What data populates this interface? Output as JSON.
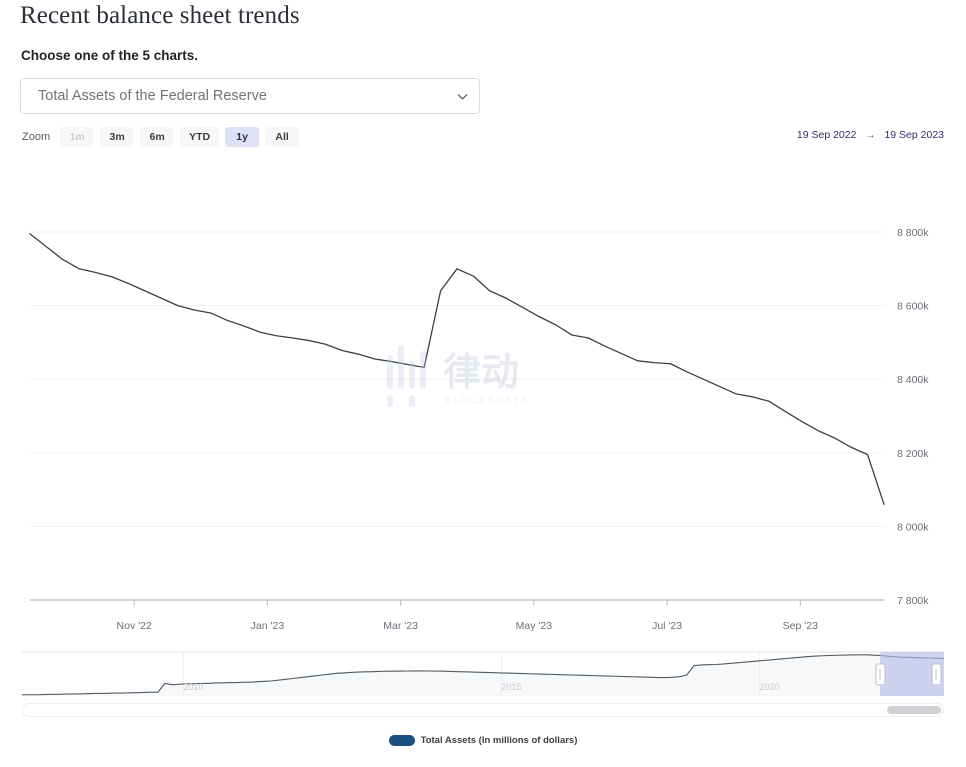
{
  "header": {
    "title": "Recent balance sheet trends",
    "subtitle": "Choose one of the 5 charts."
  },
  "selector": {
    "value": "Total Assets of the Federal Reserve",
    "chevron_icon": "chevron-down-icon",
    "options": [
      "Total Assets of the Federal Reserve"
    ]
  },
  "range_selector": {
    "label": "Zoom",
    "buttons": [
      {
        "label": "1m",
        "state": "disabled"
      },
      {
        "label": "3m",
        "state": "normal"
      },
      {
        "label": "6m",
        "state": "normal"
      },
      {
        "label": "YTD",
        "state": "normal"
      },
      {
        "label": "1y",
        "state": "selected"
      },
      {
        "label": "All",
        "state": "normal"
      }
    ],
    "date_from": "19 Sep 2022",
    "date_separator": "→",
    "date_to": "19 Sep 2023"
  },
  "navigator": {
    "year_labels": [
      "2010",
      "2015",
      "2020"
    ],
    "selection_label": "navigator-selection",
    "handle_left": "navigator-handle-left",
    "handle_right": "navigator-handle-right",
    "selection_color": "#b6bce6"
  },
  "scrollbar": {
    "thumb_label": "scrollbar-thumb"
  },
  "legend": {
    "items": [
      {
        "label": "Total Assets (In millions of dollars)",
        "color": "#1a4f82"
      }
    ]
  },
  "watermark": {
    "text": "律动",
    "subtext": "BLOCKBEATS"
  },
  "chart_data": {
    "type": "line",
    "title": "Recent balance sheet trends",
    "series_name": "Total Assets (In millions of dollars)",
    "line_color": "#3b4046",
    "xlabel": "",
    "ylabel": "",
    "ylim": [
      7800000,
      8800000
    ],
    "ytick_labels": [
      "8 800k",
      "8 600k",
      "8 400k",
      "8 200k",
      "8 000k",
      "7 800k"
    ],
    "ytick_values": [
      8800000,
      8600000,
      8400000,
      8200000,
      8000000,
      7800000
    ],
    "xtick_labels": [
      "Nov '22",
      "Jan '23",
      "Mar '23",
      "May '23",
      "Jul '23",
      "Sep '23"
    ],
    "grid": true,
    "legend_position": "bottom",
    "x": [
      "2022-09-19",
      "2022-09-28",
      "2022-10-05",
      "2022-10-12",
      "2022-10-19",
      "2022-10-26",
      "2022-11-02",
      "2022-11-09",
      "2022-11-16",
      "2022-11-23",
      "2022-11-30",
      "2022-12-07",
      "2022-12-14",
      "2022-12-21",
      "2022-12-28",
      "2023-01-04",
      "2023-01-11",
      "2023-01-18",
      "2023-01-25",
      "2023-02-01",
      "2023-02-08",
      "2023-02-15",
      "2023-02-22",
      "2023-03-01",
      "2023-03-08",
      "2023-03-15",
      "2023-03-22",
      "2023-03-29",
      "2023-04-05",
      "2023-04-12",
      "2023-04-19",
      "2023-04-26",
      "2023-05-03",
      "2023-05-10",
      "2023-05-17",
      "2023-05-24",
      "2023-05-31",
      "2023-06-07",
      "2023-06-14",
      "2023-06-21",
      "2023-06-28",
      "2023-07-05",
      "2023-07-12",
      "2023-07-19",
      "2023-07-26",
      "2023-08-02",
      "2023-08-09",
      "2023-08-16",
      "2023-08-23",
      "2023-08-30",
      "2023-09-06",
      "2023-09-13",
      "2023-09-19"
    ],
    "values": [
      8795000,
      8760000,
      8725000,
      8700000,
      8690000,
      8678000,
      8660000,
      8640000,
      8620000,
      8600000,
      8588000,
      8580000,
      8560000,
      8545000,
      8528000,
      8518000,
      8512000,
      8505000,
      8495000,
      8478000,
      8468000,
      8455000,
      8448000,
      8440000,
      8432000,
      8640000,
      8700000,
      8680000,
      8640000,
      8620000,
      8595000,
      8570000,
      8548000,
      8520000,
      8512000,
      8490000,
      8470000,
      8450000,
      8445000,
      8442000,
      8420000,
      8400000,
      8380000,
      8360000,
      8352000,
      8340000,
      8312000,
      8285000,
      8260000,
      8240000,
      8215000,
      8195000,
      8060000
    ],
    "navigator_series_note": "long-term total assets from ~2003 to 2023"
  }
}
